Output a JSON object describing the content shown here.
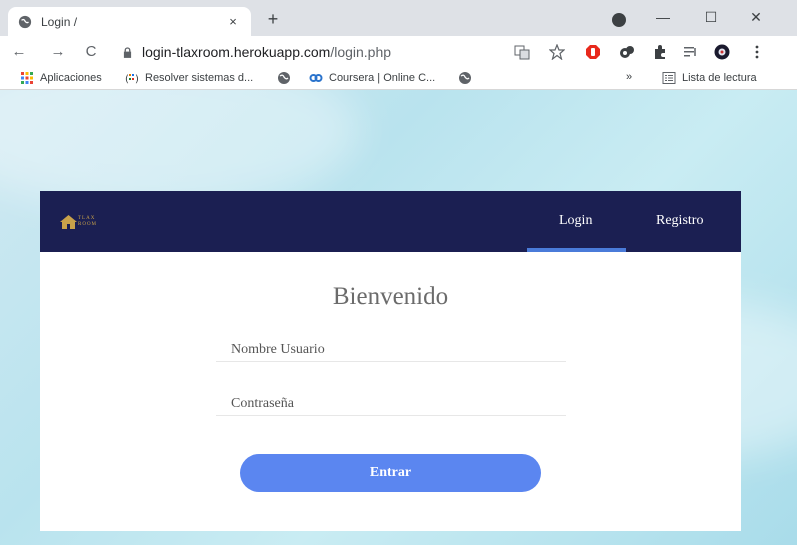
{
  "browser": {
    "tab_title": "Login /",
    "tab_close": "×",
    "new_tab": "+",
    "window_minimize": "—",
    "window_maximize": "☐",
    "window_close": "✕",
    "nav_back": "←",
    "nav_forward": "→",
    "nav_reload": "C",
    "url_host": "login-tlaxroom.herokuapp.com",
    "url_path": "/login.php",
    "bookmarks": [
      {
        "label": "Aplicaciones",
        "icon": "apps-grid-icon"
      },
      {
        "label": "Resolver sistemas d...",
        "icon": "bookmark-favicon-icon"
      },
      {
        "label": "",
        "icon": "globe-icon"
      },
      {
        "label": "Coursera | Online C...",
        "icon": "coursera-icon"
      },
      {
        "label": "",
        "icon": "globe-icon"
      }
    ],
    "bookmarks_overflow": "»",
    "reading_list": "Lista de lectura"
  },
  "site": {
    "logo_text": "TLAX ROOM",
    "nav": {
      "login": "Login",
      "register": "Registro"
    },
    "active_nav": "login",
    "welcome": "Bienvenido",
    "username_placeholder": "Nombre Usuario",
    "password_placeholder": "Contraseña",
    "submit_label": "Entrar",
    "colors": {
      "navbar": "#1b1f52",
      "accent": "#4a7bd9",
      "button": "#5b86f0"
    }
  }
}
